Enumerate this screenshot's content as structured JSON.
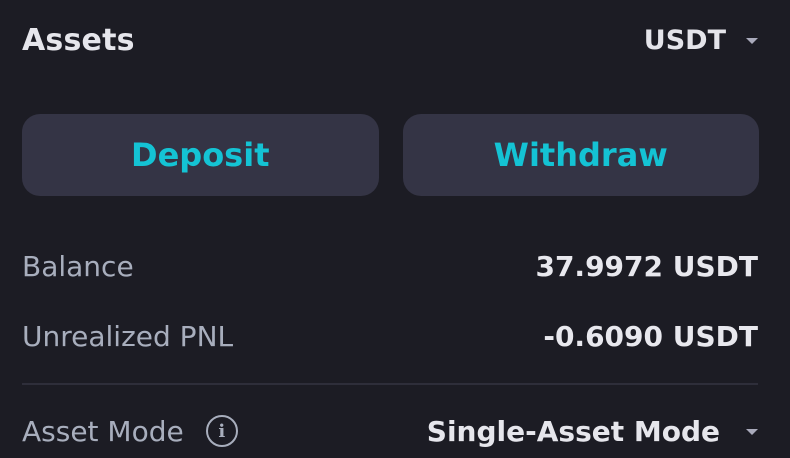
{
  "header": {
    "title": "Assets",
    "currency": "USDT",
    "currency_icon": "chevron-down-icon"
  },
  "actions": {
    "deposit_label": "Deposit",
    "withdraw_label": "Withdraw",
    "accent_color": "#14c3d4"
  },
  "stats": [
    {
      "label": "Balance",
      "value": "37.9972 USDT"
    },
    {
      "label": "Unrealized PNL",
      "value": "-0.6090 USDT"
    }
  ],
  "asset_mode": {
    "label": "Asset Mode",
    "info_icon": "info-icon",
    "value": "Single-Asset Mode",
    "dropdown_icon": "chevron-down-icon"
  }
}
